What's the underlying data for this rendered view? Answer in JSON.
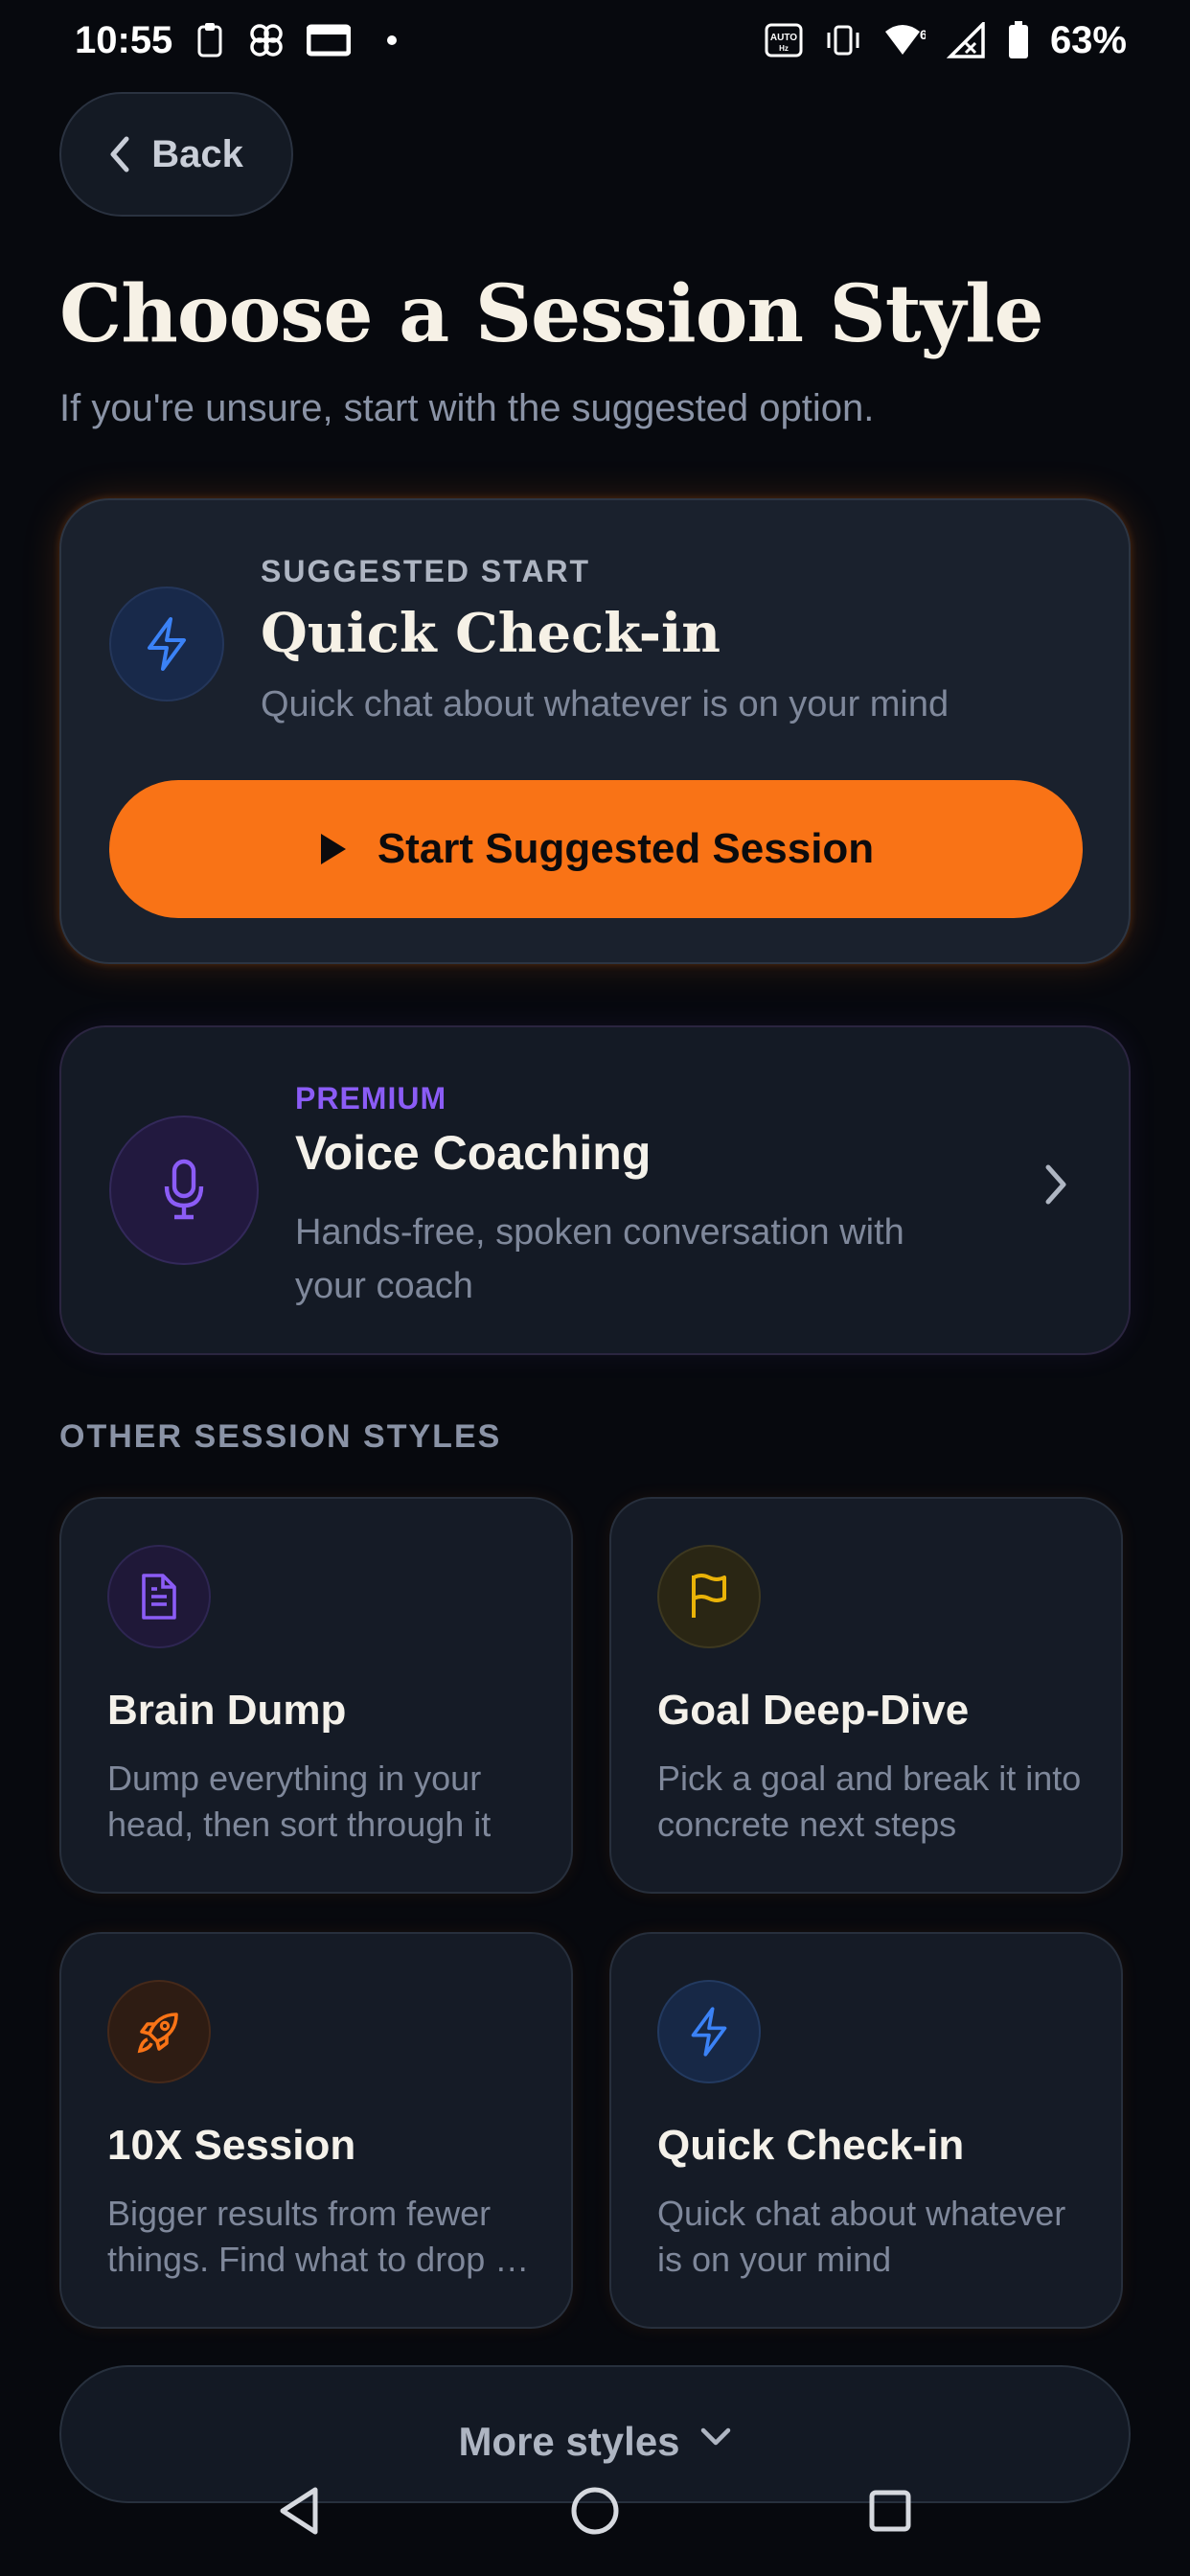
{
  "status_bar": {
    "time": "10:55",
    "battery": "63%",
    "left_icons": [
      "clipboard-icon",
      "pinwheel-icon",
      "cast-icon",
      "dot-icon"
    ],
    "right_icons": [
      "auto-hz-icon",
      "vibrate-icon",
      "wifi-6-icon",
      "no-signal-icon",
      "battery-icon"
    ]
  },
  "back_button": {
    "label": "Back"
  },
  "header": {
    "title": "Choose a Session Style",
    "subtitle": "If you're unsure, start with the suggested option."
  },
  "suggested": {
    "eyebrow": "SUGGESTED START",
    "title": "Quick Check-in",
    "description": "Quick chat about whatever is on your mind",
    "button_label": "Start Suggested Session",
    "icon": "lightning-icon"
  },
  "premium": {
    "eyebrow": "PREMIUM",
    "title": "Voice Coaching",
    "description": "Hands-free, spoken conversation with your coach",
    "icon": "microphone-icon"
  },
  "other_section": {
    "label": "OTHER SESSION STYLES",
    "tiles": [
      {
        "title": "Brain Dump",
        "description": "Dump everything in your head, then sort through it",
        "icon": "document-icon"
      },
      {
        "title": "Goal Deep-Dive",
        "description": "Pick a goal and break it into concrete next steps",
        "icon": "flag-icon"
      },
      {
        "title": "10X Session",
        "description": "Bigger results from fewer things. Find what to drop …",
        "icon": "rocket-icon"
      },
      {
        "title": "Quick Check-in",
        "description": "Quick chat about whatever is on your mind",
        "icon": "lightning-icon"
      }
    ]
  },
  "more_button": {
    "label": "More styles"
  },
  "nav_bar": {
    "icons": [
      "back-triangle-icon",
      "home-circle-icon",
      "recents-square-icon"
    ]
  },
  "colors": {
    "background": "#07090e",
    "accent_orange": "#f97316",
    "premium_purple": "#8b5cf6",
    "lightning_blue": "#3b82f6",
    "flag_yellow": "#eab308"
  }
}
